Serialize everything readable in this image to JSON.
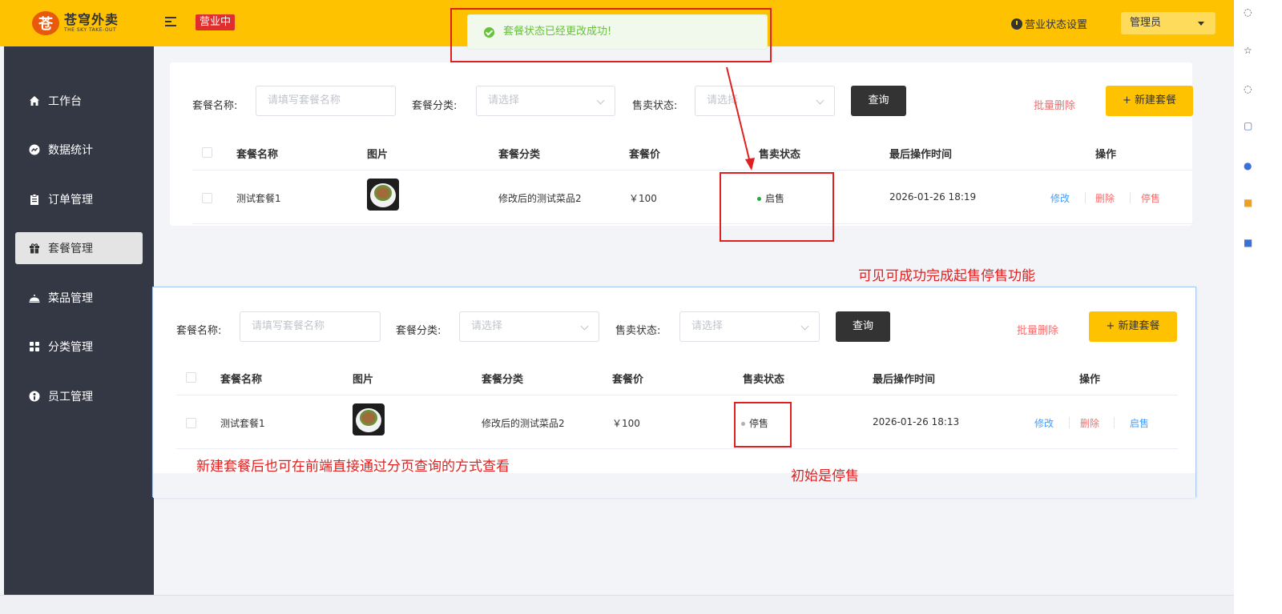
{
  "header": {
    "logo_mark": "苍",
    "logo_main": "苍穹外卖",
    "logo_sub": "THE SKY TAKE-OUT",
    "status_tag": "营业中",
    "biz_setting": "营业状态设置",
    "admin_name": "管理员",
    "bg_color": "#ffc200"
  },
  "sidebar": {
    "items": [
      {
        "label": "工作台",
        "icon": "home-icon"
      },
      {
        "label": "数据统计",
        "icon": "chart-icon"
      },
      {
        "label": "订单管理",
        "icon": "clipboard-icon"
      },
      {
        "label": "套餐管理",
        "icon": "gift-icon",
        "active": true
      },
      {
        "label": "菜品管理",
        "icon": "dish-icon"
      },
      {
        "label": "分类管理",
        "icon": "grid-icon"
      },
      {
        "label": "员工管理",
        "icon": "user-icon"
      }
    ]
  },
  "toast": {
    "message": "套餐状态已经更改成功!",
    "color": "#67c23a"
  },
  "filters": {
    "name_label": "套餐名称:",
    "name_placeholder": "请填写套餐名称",
    "category_label": "套餐分类:",
    "category_placeholder": "请选择",
    "status_label": "售卖状态:",
    "status_placeholder": "请选择",
    "query_button": "查询",
    "batch_delete": "批量删除",
    "new_button": "+ 新建套餐"
  },
  "table": {
    "columns": [
      "套餐名称",
      "图片",
      "套餐分类",
      "套餐价",
      "售卖状态",
      "最后操作时间",
      "操作"
    ]
  },
  "panel1_row": {
    "name": "测试套餐1",
    "category": "修改后的测试菜品2",
    "price": "￥100",
    "status": "启售",
    "status_color": "#22ac38",
    "time": "2026-01-26 18:19",
    "op_edit": "修改",
    "op_delete": "删除",
    "op_toggle": "停售"
  },
  "panel2_row": {
    "name": "测试套餐1",
    "category": "修改后的测试菜品2",
    "price": "￥100",
    "status": "停售",
    "status_color": "#b0b0b0",
    "time": "2026-01-26 18:13",
    "op_edit": "修改",
    "op_delete": "删除",
    "op_toggle": "启售"
  },
  "annotations": {
    "success_note": "可见可成功完成起售停售功能",
    "new_note": "新建套餐后也可在前端直接通过分页查询的方式查看",
    "initial_note": "初始是停售",
    "color": "#e02020"
  }
}
